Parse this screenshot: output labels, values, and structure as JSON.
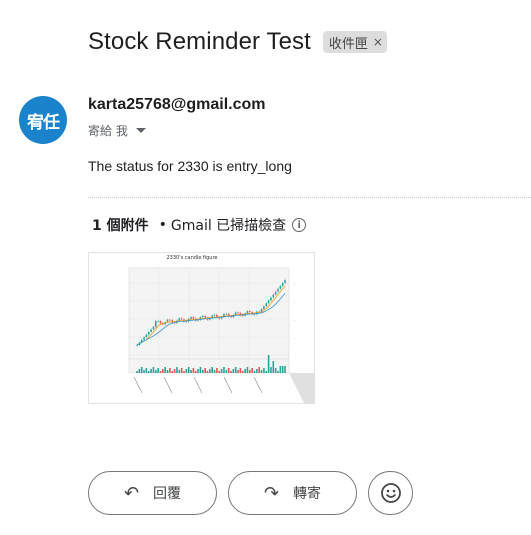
{
  "email": {
    "subject": "Stock Reminder Test",
    "label": "收件匣",
    "label_remove": "×",
    "avatar_text": "宥任",
    "sender": "karta25768@gmail.com",
    "recipient": "寄給 我",
    "body": "The status for 2330 is entry_long"
  },
  "attachments": {
    "count_label": "1 個附件",
    "scan_label": "Gmail 已掃描檢查",
    "bullet": "•",
    "thumbnail_title": "2330's candle figure"
  },
  "actions": {
    "reply_label": "回覆",
    "forward_label": "轉寄",
    "reply_icon": "reply-arrow",
    "forward_icon": "forward-arrow",
    "emoji_icon": "smiley-face"
  },
  "colors": {
    "avatar": "#1a83cc",
    "up_candle": "#26a69a",
    "down_candle": "#ef5350"
  }
}
